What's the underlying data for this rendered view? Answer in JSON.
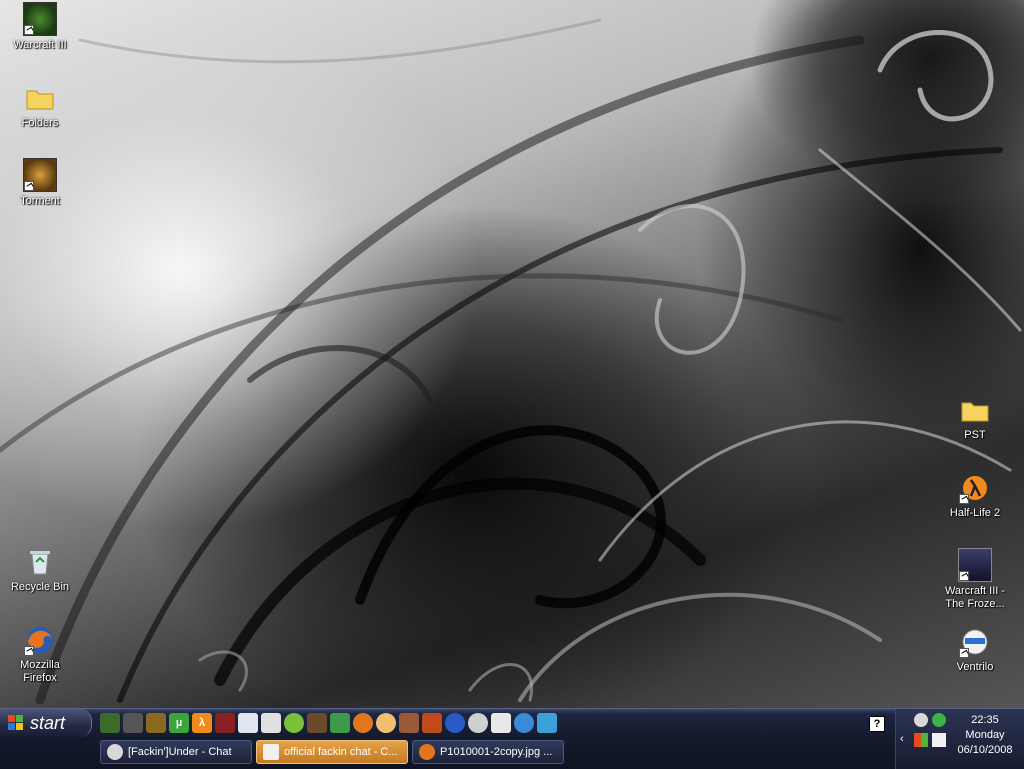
{
  "desktop_icons": {
    "warcraft3": "Warcraft III",
    "folders": "Folders",
    "torment": "Torment",
    "recycle_bin": "Recycle Bin",
    "firefox_line1": "Mozzilla",
    "firefox_line2": "Firefox",
    "pst": "PST",
    "half_life2": "Half-Life 2",
    "warcraft3_tft_line1": "Warcraft III -",
    "warcraft3_tft_line2": "The Froze...",
    "ventrilo": "Ventrilo"
  },
  "taskbar": {
    "start_label": "start",
    "tasks": [
      {
        "label": "[Fackin']Under - Chat",
        "icon": "steam-icon"
      },
      {
        "label": "official fackin chat - C...",
        "icon": "ventrilo-chat-icon",
        "active": true
      },
      {
        "label": "P1010001-2copy.jpg ...",
        "icon": "firefox-icon"
      }
    ],
    "help_label": "?",
    "clock": {
      "time": "22:35",
      "day": "Monday",
      "date": "06/10/2008"
    },
    "expand_label": "‹"
  },
  "quick_launch": [
    "warcraft-icon",
    "wraith-icon",
    "diablo-icon",
    "utorrent-icon",
    "half-life-icon",
    "starcraft-icon",
    "ventrilo-icon",
    "steam-icon",
    "green-app-icon",
    "torment-icon",
    "shield-icon",
    "firefox-icon",
    "face-icon",
    "avatar-icon",
    "warcraft-tft-icon",
    "media-player-icon",
    "cd-icon",
    "display-icon",
    "globe-icon",
    "messenger-icon"
  ],
  "colors": {
    "taskbar": "#141a2c",
    "active_task": "#d88e36"
  }
}
